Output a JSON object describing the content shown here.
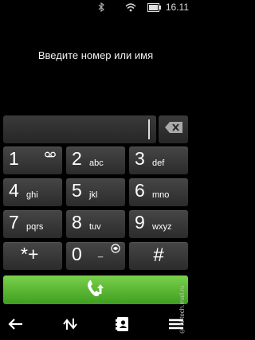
{
  "status": {
    "time": "16.11"
  },
  "prompt": "Введите номер или имя",
  "keys": [
    {
      "digit": "1",
      "letters": ""
    },
    {
      "digit": "2",
      "letters": "abc"
    },
    {
      "digit": "3",
      "letters": "def"
    },
    {
      "digit": "4",
      "letters": "ghi"
    },
    {
      "digit": "5",
      "letters": "jkl"
    },
    {
      "digit": "6",
      "letters": "mno"
    },
    {
      "digit": "7",
      "letters": "pqrs"
    },
    {
      "digit": "8",
      "letters": "tuv"
    },
    {
      "digit": "9",
      "letters": "wxyz"
    },
    {
      "digit": "*+",
      "letters": ""
    },
    {
      "digit": "0",
      "letters": "_"
    },
    {
      "digit": "#",
      "letters": ""
    }
  ],
  "watermark": "© hi-tech.mail.ru",
  "colors": {
    "call_green": "#5bbd2f",
    "key_bg": "#3a3a3a",
    "background": "#000000"
  },
  "icons": [
    "bluetooth-icon",
    "wifi-icon",
    "battery-icon",
    "backspace-icon",
    "voicemail-icon",
    "call-icon",
    "back-arrow-icon",
    "transfer-icon",
    "contacts-icon",
    "menu-icon"
  ]
}
